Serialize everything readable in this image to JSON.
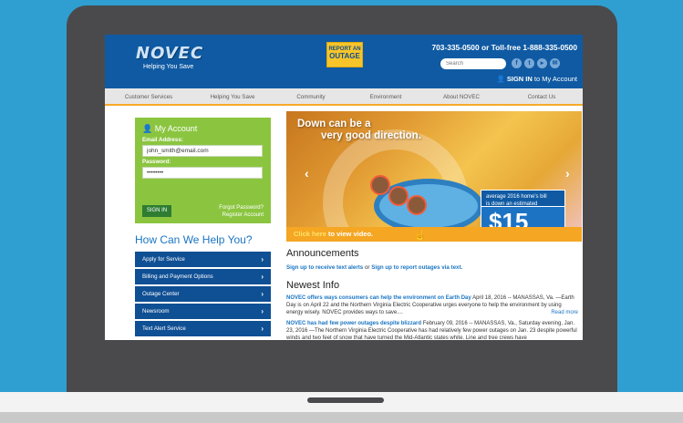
{
  "header": {
    "brand": "NOVEC",
    "tagline": "Helping You Save",
    "report_line1": "REPORT AN",
    "report_line2": "OUTAGE",
    "phone": "703-335-0500 or Toll-free 1-888-335-0500",
    "search_placeholder": "Search",
    "signin_bold": "SIGN IN",
    "signin_rest": "to My Account"
  },
  "nav": [
    "Customer Services",
    "Helping You Save",
    "Community",
    "Environment",
    "About NOVEC",
    "Contact Us"
  ],
  "account": {
    "title": "My Account",
    "email_label": "Email Address:",
    "email_value": "john_smith@email.com",
    "password_label": "Password:",
    "password_value": "••••••••",
    "signin_button": "SIGN IN",
    "forgot": "Forgot Password?",
    "register": "Register Account"
  },
  "help": {
    "heading": "How Can We Help You?",
    "items": [
      "Apply for Service",
      "Billing and Payment Options",
      "Outage Center",
      "Newsroom",
      "Text Alert Service"
    ],
    "arrow": "›"
  },
  "hero": {
    "headline_1": "Down can be a",
    "headline_2": "very good direction.",
    "badge_1": "average 2016 home's bill",
    "badge_2": "is down an estimated",
    "amount": "$15",
    "unit": "month",
    "cta_link": "Click here",
    "cta_rest": "to view video.",
    "prev": "‹",
    "next": "›"
  },
  "announcements": {
    "heading": "Announcements",
    "link1": "Sign up to receive text alerts",
    "or": "or",
    "link2": "Sign up to report outages via text."
  },
  "news": {
    "heading": "Newest Info",
    "items": [
      {
        "title": "NOVEC offers ways consumers can help the environment on Earth Day",
        "body": "April 18, 2016 -- MANASSAS, Va. —Earth Day is on April 22 and the Northern Virginia Electric Cooperative urges everyone to help the environment by using energy wisely. NOVEC provides ways to save....",
        "more": "Read more"
      },
      {
        "title": "NOVEC has had few power outages despite blizzard",
        "body": "February 09, 2016 -- MANASSAS, Va., Saturday evening, Jan. 23, 2016 —The Northern Virginia Electric Cooperative has had relatively few power outages on Jan. 23 despite powerful winds and two feet of snow that have turned the Mid-Atlantic states white. Line and tree crews have"
      }
    ]
  },
  "colors": {
    "header": "#0f5aa3",
    "account": "#8bc540",
    "cta": "#f5a623",
    "link": "#1a75c2",
    "background": "#2f9fd1"
  }
}
